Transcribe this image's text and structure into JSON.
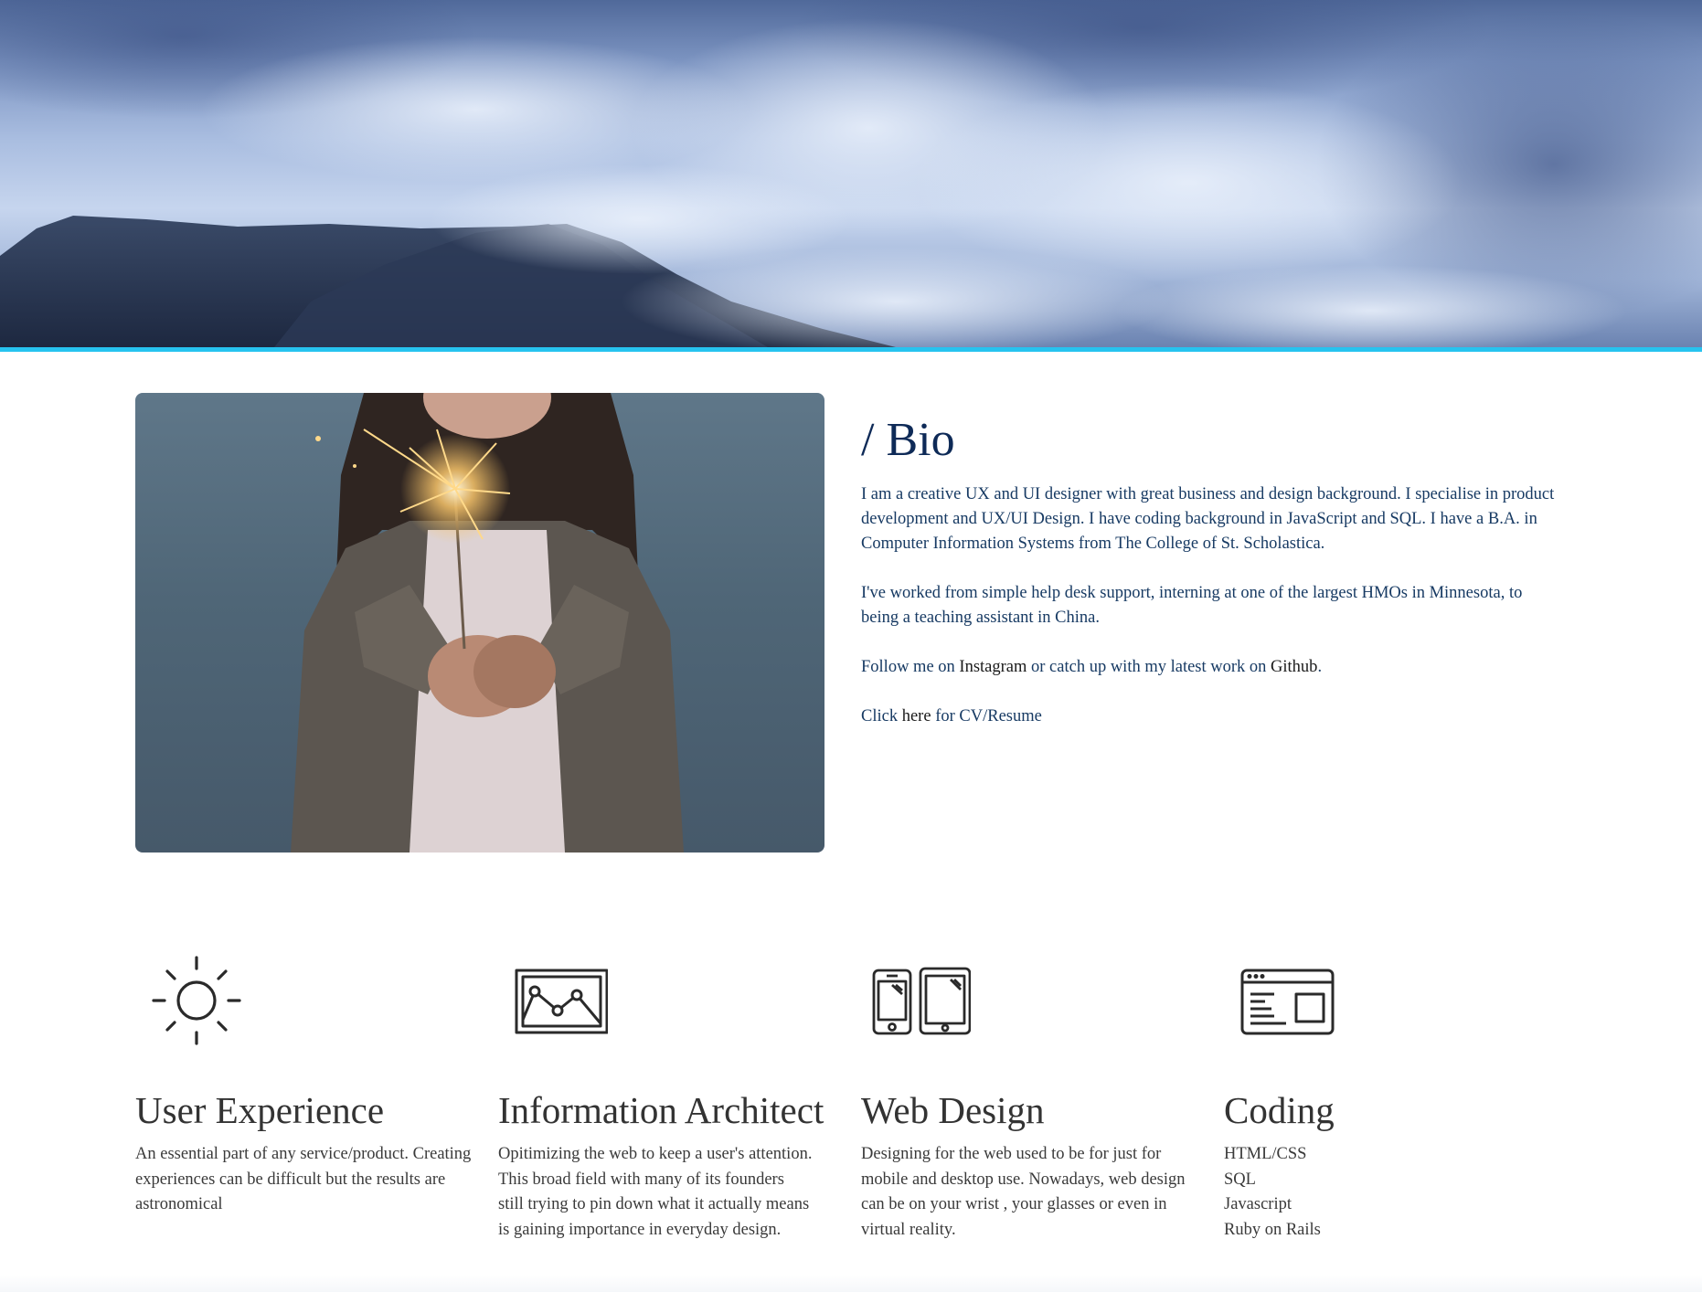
{
  "bio": {
    "title": "/ Bio",
    "paragraph1": "I am a creative UX and UI designer with great business and design background. I specialise in product development and UX/UI Design. I have coding background in JavaScript and SQL. I have a B.A. in Computer Information Systems from The College of St. Scholastica.",
    "paragraph2": "I've worked from simple help desk support, interning at one of the largest HMOs in Minnesota, to being a teaching assistant in China.",
    "follow_prefix": "Follow me on ",
    "instagram_link": "Instagram",
    "follow_middle": " or catch up with my latest work on ",
    "github_link": "Github",
    "follow_suffix": ".",
    "cv_prefix": "Click ",
    "cv_link": "here",
    "cv_suffix": " for CV/Resume"
  },
  "features": [
    {
      "icon": "sun-icon",
      "title": "User Experience",
      "description": "An essential part of any service/product. Creating experiences can be difficult but the results are astronomical"
    },
    {
      "icon": "line-chart-frame-icon",
      "title": "Information Architect",
      "description": "Opitimizing the web to keep a user's attention.\n This broad field with many of its founders\n still trying to pin down what it actually means\nis gaining importance in everyday design."
    },
    {
      "icon": "phone-tablet-icon",
      "title": "Web Design",
      "description": "Designing for the web used to be for just for mobile and desktop use. Nowadays, web design can be on your wrist , your glasses or even in virtual reality."
    },
    {
      "icon": "browser-window-icon",
      "title": "Coding",
      "skills": [
        "HTML/CSS",
        "SQL",
        "Javascript",
        "Ruby on Rails"
      ]
    }
  ],
  "colors": {
    "accent_border": "#27c3ef",
    "bio_text": "#173a63",
    "heading_text": "#333333"
  }
}
